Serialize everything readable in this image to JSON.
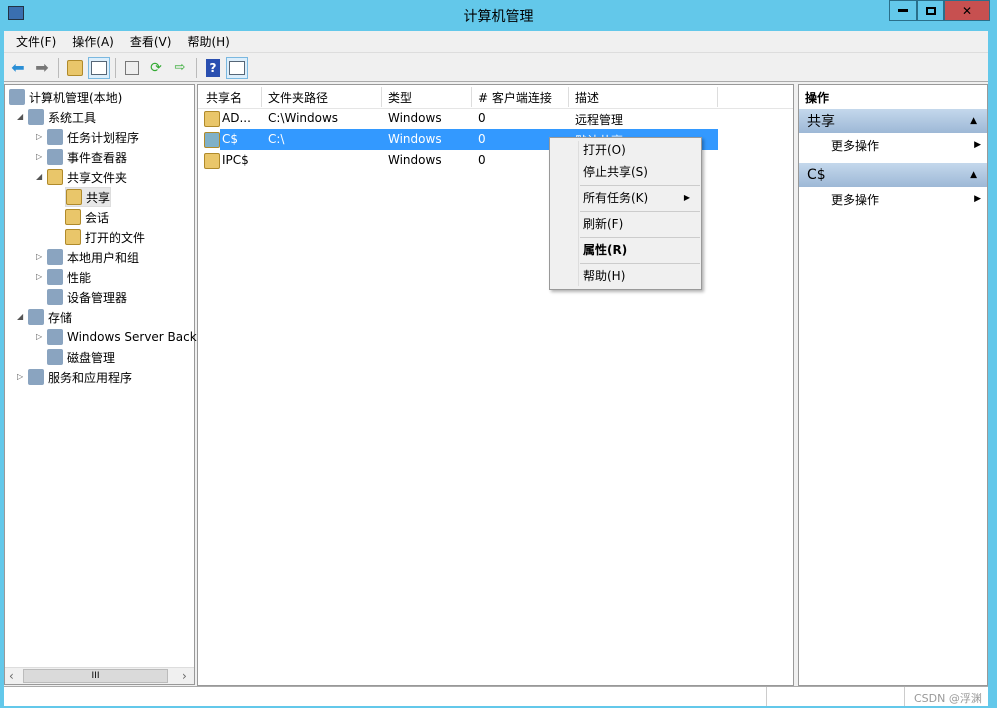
{
  "window": {
    "title": "计算机管理"
  },
  "menu": [
    "文件(F)",
    "操作(A)",
    "查看(V)",
    "帮助(H)"
  ],
  "tree": [
    {
      "label": "计算机管理(本地)",
      "level": 0,
      "exp": ""
    },
    {
      "label": "系统工具",
      "level": 1,
      "exp": "◢"
    },
    {
      "label": "任务计划程序",
      "level": 2,
      "exp": "▷"
    },
    {
      "label": "事件查看器",
      "level": 2,
      "exp": "▷"
    },
    {
      "label": "共享文件夹",
      "level": 2,
      "exp": "◢"
    },
    {
      "label": "共享",
      "level": 3,
      "exp": ""
    },
    {
      "label": "会话",
      "level": 3,
      "exp": ""
    },
    {
      "label": "打开的文件",
      "level": 3,
      "exp": ""
    },
    {
      "label": "本地用户和组",
      "level": 2,
      "exp": "▷"
    },
    {
      "label": "性能",
      "level": 2,
      "exp": "▷"
    },
    {
      "label": "设备管理器",
      "level": 2,
      "exp": ""
    },
    {
      "label": "存储",
      "level": 1,
      "exp": "◢"
    },
    {
      "label": "Windows Server Back",
      "level": 2,
      "exp": "▷"
    },
    {
      "label": "磁盘管理",
      "level": 2,
      "exp": ""
    },
    {
      "label": "服务和应用程序",
      "level": 1,
      "exp": "▷"
    }
  ],
  "columns": [
    "共享名",
    "文件夹路径",
    "类型",
    "# 客户端连接",
    "描述"
  ],
  "rows": [
    [
      "AD...",
      "C:\\Windows",
      "Windows",
      "0",
      "远程管理"
    ],
    [
      "C$",
      "C:\\",
      "Windows",
      "0",
      "默认共享"
    ],
    [
      "IPC$",
      "",
      "Windows",
      "0",
      ""
    ]
  ],
  "actions": {
    "header": "操作",
    "sections": [
      {
        "title": "共享",
        "more": "更多操作"
      },
      {
        "title": "C$",
        "more": "更多操作"
      }
    ]
  },
  "context_menu": {
    "open": "打开(O)",
    "stop": "停止共享(S)",
    "all_tasks": "所有任务(K)",
    "refresh": "刷新(F)",
    "properties": "属性(R)",
    "help": "帮助(H)"
  },
  "scrollbar": {
    "thumb": "III"
  },
  "watermark": "CSDN @浮渊",
  "colors": {
    "selection": "#3399ff",
    "titlebar": "#63c8ea",
    "close": "#c75050"
  }
}
